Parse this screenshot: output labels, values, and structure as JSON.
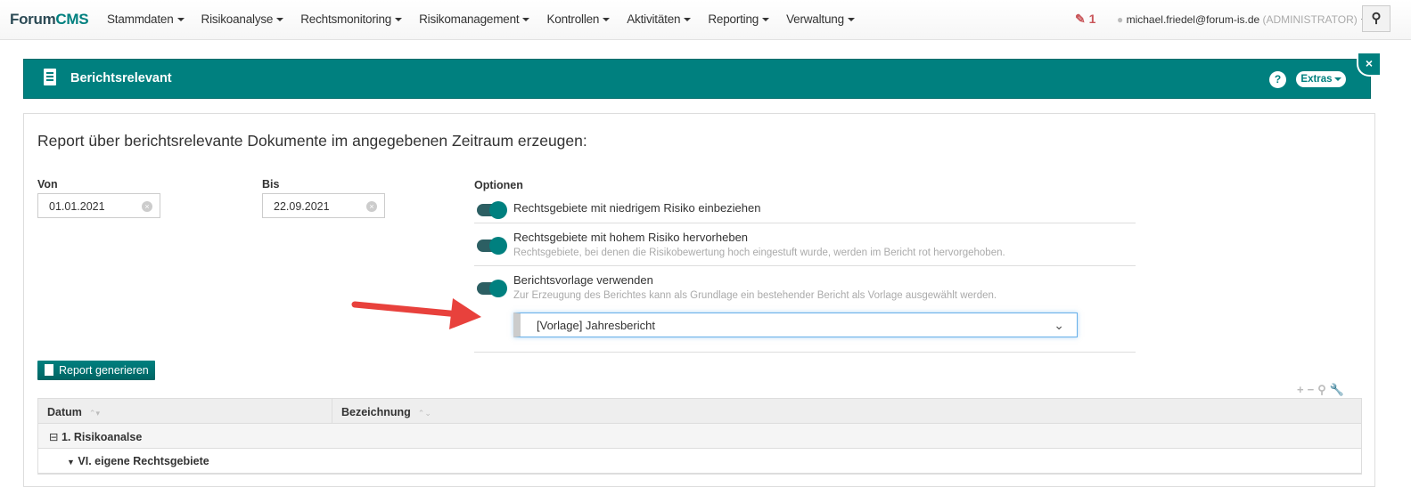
{
  "app": {
    "brand_a": "Forum",
    "brand_b": "CMS"
  },
  "nav": {
    "items": [
      "Stammdaten",
      "Risikoanalyse",
      "Rechtsmonitoring",
      "Risikomanagement",
      "Kontrollen",
      "Aktivitäten",
      "Reporting",
      "Verwaltung"
    ],
    "edit_count": "1",
    "user": "michael.friedel@forum-is.de",
    "role": "(ADMINISTRATOR)"
  },
  "header": {
    "title": "Berichtsrelevant",
    "help": "?",
    "extras": "Extras",
    "close": "×"
  },
  "form": {
    "title": "Report über berichtsrelevante Dokumente im angegebenen Zeitraum erzeugen:",
    "von_label": "Von",
    "von_value": "01.01.2021",
    "bis_label": "Bis",
    "bis_value": "22.09.2021",
    "options_label": "Optionen",
    "options": [
      {
        "label": "Rechtsgebiete mit niedrigem Risiko einbeziehen",
        "enabled": true
      },
      {
        "label": "Rechtsgebiete mit hohem Risiko hervorheben",
        "hint": "Rechtsgebiete, bei denen die Risikobewertung hoch eingestuft wurde, werden im Bericht rot hervorgehoben.",
        "enabled": true
      },
      {
        "label": "Berichtsvorlage verwenden",
        "hint": "Zur Erzeugung des Berichtes kann als Grundlage ein bestehender Bericht als Vorlage ausgewählt werden.",
        "enabled": true
      }
    ],
    "template_value": "[Vorlage] Jahresbericht",
    "generate_button": "Report generieren"
  },
  "table": {
    "columns": [
      "Datum",
      "Bezeichnung"
    ],
    "rows": [
      "1. Risikoanalse",
      "VI. eigene Rechtsgebiete"
    ]
  },
  "colors": {
    "accent": "#00807f",
    "annotation_arrow": "#e8413c"
  }
}
